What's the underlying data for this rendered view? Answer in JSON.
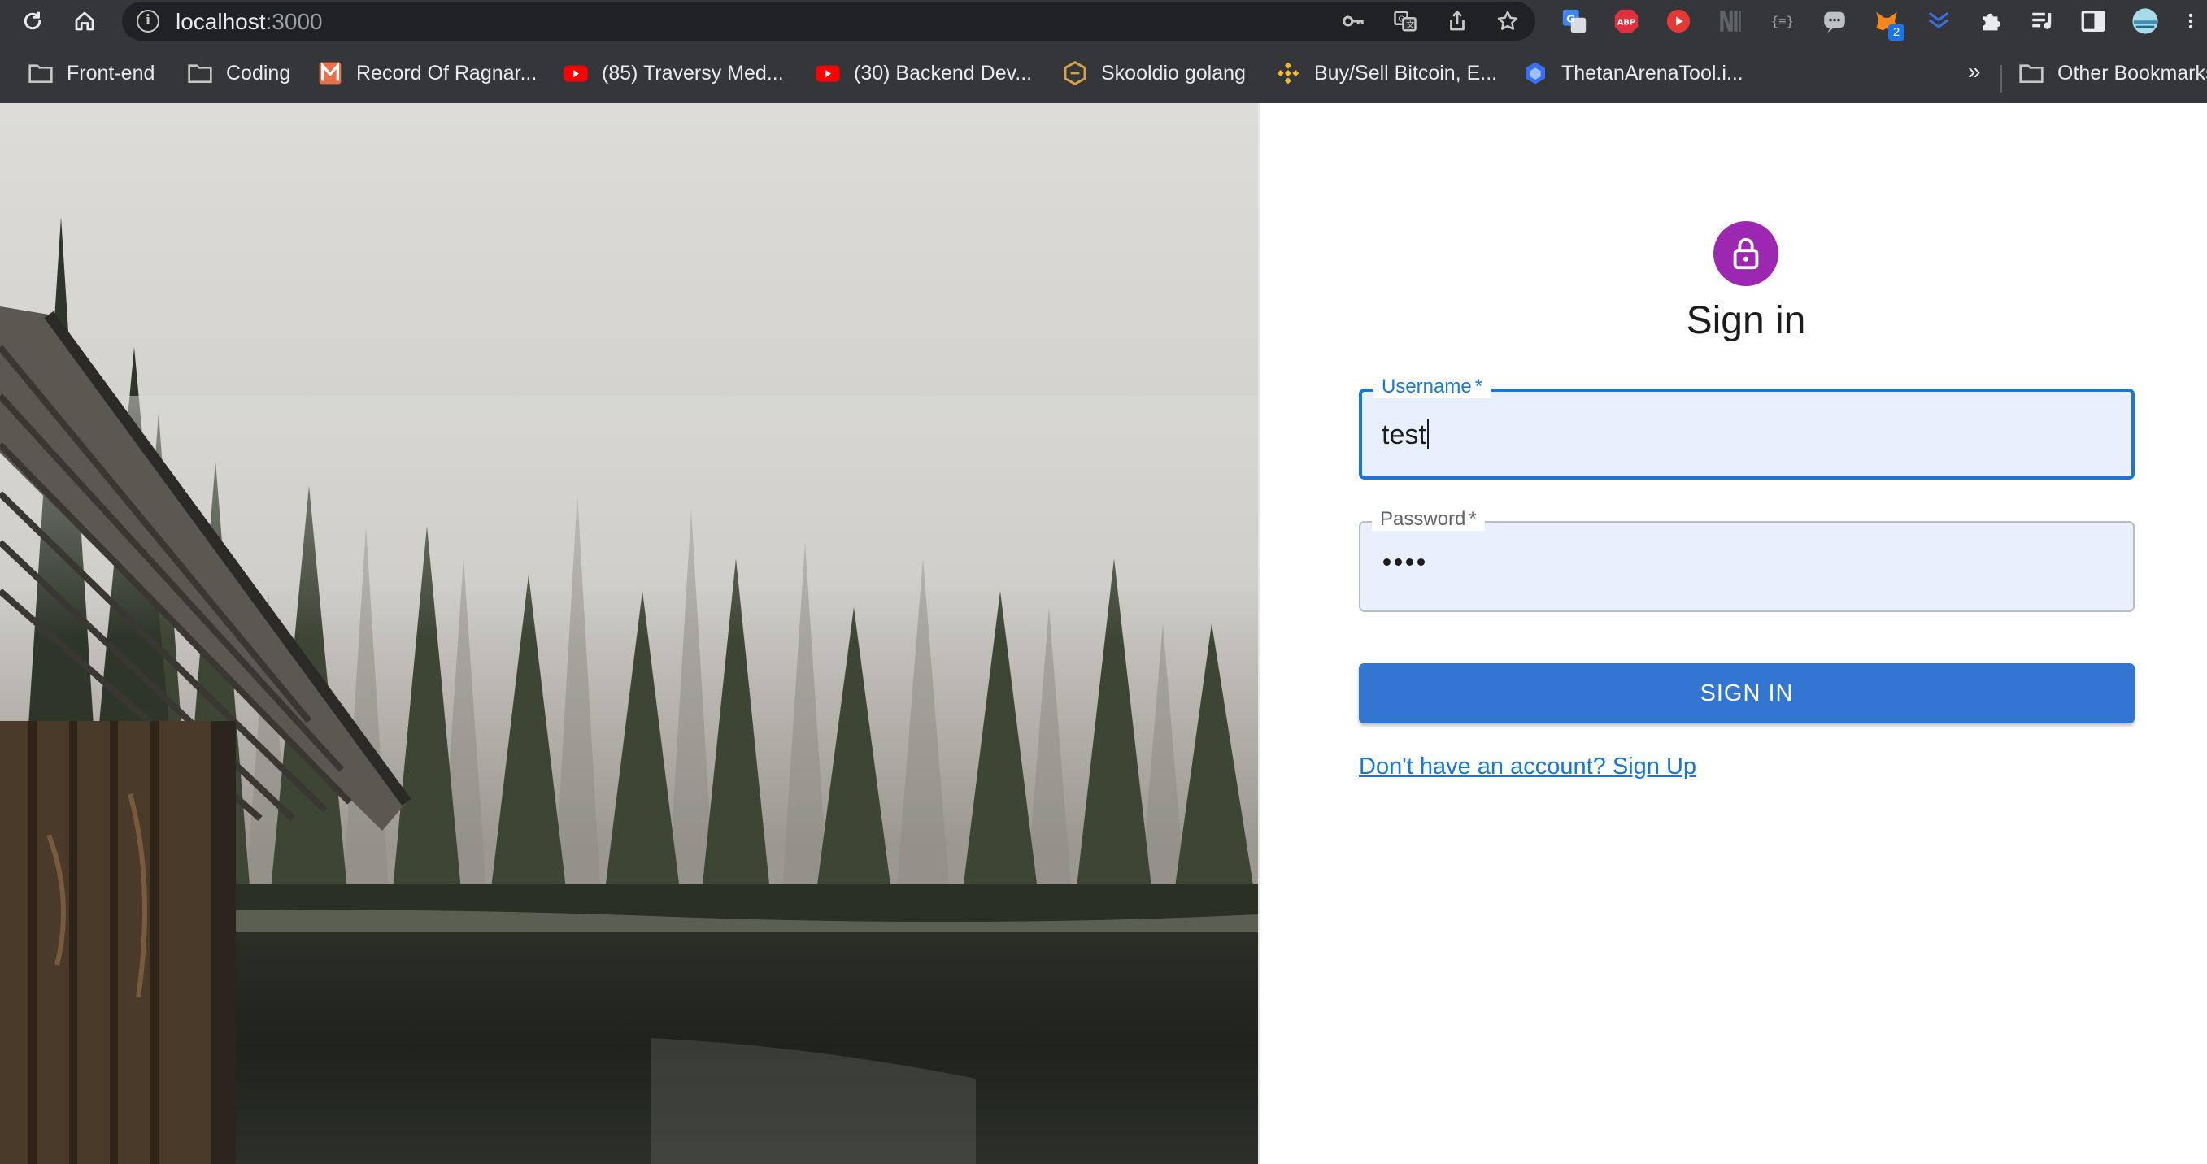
{
  "browser": {
    "url_host": "localhost",
    "url_port": ":3000",
    "toolbar_icons": [
      "reload-icon",
      "home-icon",
      "site-info-icon"
    ],
    "omnibox_actions": [
      "key-icon",
      "translate-icon",
      "share-icon",
      "bookmark-star-icon"
    ],
    "extensions": [
      {
        "name": "google-translate-extension-icon"
      },
      {
        "name": "adblock-plus-extension-icon",
        "label": "ABP"
      },
      {
        "name": "video-player-extension-icon"
      },
      {
        "name": "notion-extension-icon"
      },
      {
        "name": "json-viewer-extension-icon",
        "label": "{≡}"
      },
      {
        "name": "chat-extension-icon"
      },
      {
        "name": "metamask-extension-icon",
        "badge": "2"
      },
      {
        "name": "chevron-extension-icon"
      },
      {
        "name": "puzzle-extensions-icon"
      },
      {
        "name": "media-control-icon"
      },
      {
        "name": "side-panel-icon"
      },
      {
        "name": "profile-avatar-icon"
      },
      {
        "name": "kebab-menu-icon"
      }
    ],
    "bookmarks": [
      {
        "label": "Front-end",
        "icon": "folder-icon"
      },
      {
        "label": "Coding",
        "icon": "folder-icon"
      },
      {
        "label": "Record Of Ragnar...",
        "icon": "manga-site-icon"
      },
      {
        "label": "(85) Traversy Med...",
        "icon": "youtube-icon"
      },
      {
        "label": "(30) Backend Dev...",
        "icon": "youtube-icon"
      },
      {
        "label": "Skooldio golang",
        "icon": "skooldio-icon"
      },
      {
        "label": "Buy/Sell Bitcoin, E...",
        "icon": "binance-icon"
      },
      {
        "label": "ThetanArenaTool.i...",
        "icon": "thetan-icon"
      }
    ],
    "overflow_label": "»",
    "other_bookmarks": {
      "label": "Other Bookmarks",
      "icon": "folder-icon"
    }
  },
  "page": {
    "hero_image": "foggy-forest-lake-with-cabin-photo",
    "title": "Sign in",
    "lock_icon": "lock-icon",
    "avatar_color": "#9c27b0",
    "username": {
      "label": "Username",
      "required_mark": "*",
      "value": "test"
    },
    "password": {
      "label": "Password",
      "required_mark": "*",
      "masked_length": 4
    },
    "submit_label": "SIGN IN",
    "submit_color": "#3376d1",
    "signup_link": "Don't have an account? Sign Up"
  }
}
